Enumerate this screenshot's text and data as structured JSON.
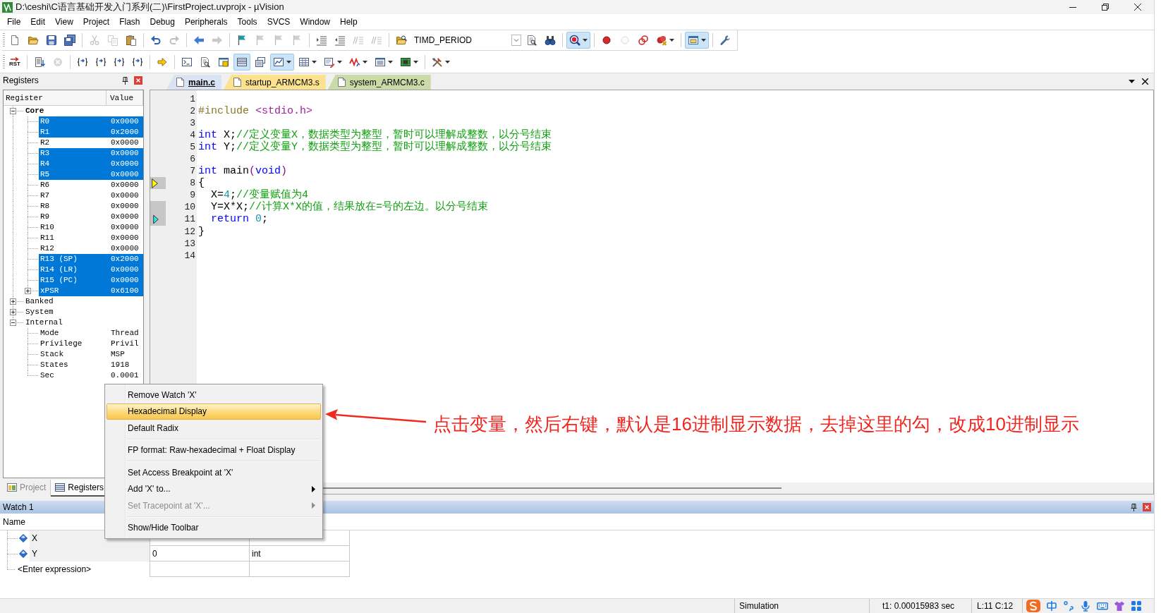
{
  "window": {
    "title": "D:\\ceshi\\C语言基础开发入门系列(二)\\FirstProject.uvprojx - µVision"
  },
  "menu": [
    "File",
    "Edit",
    "View",
    "Project",
    "Flash",
    "Debug",
    "Peripherals",
    "Tools",
    "SVCS",
    "Window",
    "Help"
  ],
  "toolbars": [
    {
      "groups": [
        {
          "items": [
            {
              "kind": "button",
              "disabled": false,
              "pressed": false,
              "dropdown": false
            },
            {
              "kind": "button",
              "disabled": false,
              "pressed": false,
              "dropdown": false
            },
            {
              "kind": "button",
              "disabled": false,
              "pressed": false,
              "dropdown": false
            },
            {
              "kind": "button",
              "disabled": false,
              "pressed": false,
              "dropdown": false
            }
          ]
        },
        {
          "items": [
            {
              "kind": "button",
              "disabled": true,
              "pressed": false,
              "dropdown": false
            },
            {
              "kind": "button",
              "disabled": true,
              "pressed": false,
              "dropdown": false
            },
            {
              "kind": "button",
              "disabled": false,
              "pressed": false,
              "dropdown": false
            }
          ]
        },
        {
          "items": [
            {
              "kind": "button",
              "disabled": false,
              "pressed": false,
              "dropdown": false
            },
            {
              "kind": "button",
              "disabled": true,
              "pressed": false,
              "dropdown": false
            }
          ]
        },
        {
          "items": [
            {
              "kind": "button",
              "disabled": false,
              "pressed": false,
              "dropdown": false
            },
            {
              "kind": "button",
              "disabled": true,
              "pressed": false,
              "dropdown": false
            }
          ]
        },
        {
          "items": [
            {
              "kind": "button",
              "disabled": false,
              "pressed": false,
              "dropdown": false
            },
            {
              "kind": "button",
              "disabled": true,
              "pressed": false,
              "dropdown": false
            },
            {
              "kind": "button",
              "disabled": true,
              "pressed": false,
              "dropdown": false
            },
            {
              "kind": "button",
              "disabled": true,
              "pressed": false,
              "dropdown": false
            }
          ]
        },
        {
          "items": [
            {
              "kind": "button",
              "disabled": false,
              "pressed": false,
              "dropdown": false
            },
            {
              "kind": "button",
              "disabled": false,
              "pressed": false,
              "dropdown": false
            },
            {
              "kind": "button",
              "disabled": true,
              "pressed": false,
              "dropdown": false
            },
            {
              "kind": "button",
              "disabled": true,
              "pressed": false,
              "dropdown": false
            }
          ]
        },
        {
          "items": [
            {
              "kind": "button",
              "disabled": false,
              "pressed": false,
              "dropdown": false
            },
            {
              "kind": "combo",
              "value": "TIMD_PERIOD"
            },
            {
              "kind": "button",
              "disabled": false,
              "pressed": false,
              "dropdown": false
            },
            {
              "kind": "button",
              "disabled": false,
              "pressed": false,
              "dropdown": false
            }
          ]
        },
        {
          "items": [
            {
              "kind": "button",
              "disabled": false,
              "pressed": true,
              "dropdown": true
            }
          ]
        },
        {
          "items": [
            {
              "kind": "button",
              "disabled": false,
              "pressed": false,
              "dropdown": false
            },
            {
              "kind": "button",
              "disabled": true,
              "pressed": false,
              "dropdown": false
            },
            {
              "kind": "button",
              "disabled": false,
              "pressed": false,
              "dropdown": false
            },
            {
              "kind": "button",
              "disabled": false,
              "pressed": false,
              "dropdown": true
            }
          ]
        },
        {
          "items": [
            {
              "kind": "button",
              "disabled": false,
              "pressed": true,
              "dropdown": true
            }
          ]
        },
        {
          "items": [
            {
              "kind": "button",
              "disabled": false,
              "pressed": false,
              "dropdown": false
            }
          ]
        }
      ]
    },
    {
      "groups": [
        {
          "items": [
            {
              "kind": "button",
              "label": "RST",
              "disabled": false,
              "pressed": false,
              "dropdown": false
            }
          ]
        },
        {
          "items": [
            {
              "kind": "button",
              "disabled": false,
              "pressed": false,
              "dropdown": false
            },
            {
              "kind": "button",
              "disabled": true,
              "pressed": false,
              "dropdown": false
            }
          ]
        },
        {
          "items": [
            {
              "kind": "button",
              "disabled": false,
              "pressed": false,
              "dropdown": false
            },
            {
              "kind": "button",
              "disabled": false,
              "pressed": false,
              "dropdown": false
            },
            {
              "kind": "button",
              "disabled": false,
              "pressed": false,
              "dropdown": false
            },
            {
              "kind": "button",
              "disabled": false,
              "pressed": false,
              "dropdown": false
            }
          ]
        },
        {
          "items": [
            {
              "kind": "button",
              "disabled": false,
              "pressed": false,
              "dropdown": false
            }
          ]
        },
        {
          "items": [
            {
              "kind": "button",
              "disabled": false,
              "pressed": false,
              "dropdown": false
            },
            {
              "kind": "button",
              "disabled": false,
              "pressed": false,
              "dropdown": false
            },
            {
              "kind": "button",
              "disabled": false,
              "pressed": false,
              "dropdown": false
            },
            {
              "kind": "button",
              "disabled": false,
              "pressed": true,
              "dropdown": false
            },
            {
              "kind": "button",
              "disabled": false,
              "pressed": false,
              "dropdown": false
            },
            {
              "kind": "button",
              "disabled": false,
              "pressed": true,
              "dropdown": true
            },
            {
              "kind": "button",
              "disabled": false,
              "pressed": false,
              "dropdown": true
            },
            {
              "kind": "button",
              "disabled": false,
              "pressed": false,
              "dropdown": true
            },
            {
              "kind": "button",
              "disabled": false,
              "pressed": false,
              "dropdown": true
            },
            {
              "kind": "button",
              "disabled": false,
              "pressed": false,
              "dropdown": true
            },
            {
              "kind": "button",
              "disabled": false,
              "pressed": false,
              "dropdown": true
            }
          ]
        },
        {
          "items": [
            {
              "kind": "button",
              "disabled": false,
              "pressed": false,
              "dropdown": true
            }
          ]
        }
      ]
    }
  ],
  "registers_panel": {
    "title": "Registers",
    "columns": [
      "Register",
      "Value"
    ],
    "tree": [
      {
        "kind": "node",
        "label": "Core",
        "expanded": true,
        "emphasized": true,
        "changed": false,
        "children": [
          {
            "kind": "leaf",
            "label": "R0",
            "value": "0x0000",
            "changed": true
          },
          {
            "kind": "leaf",
            "label": "R1",
            "value": "0x2000",
            "changed": true
          },
          {
            "kind": "leaf",
            "label": "R2",
            "value": "0x0000",
            "changed": false
          },
          {
            "kind": "leaf",
            "label": "R3",
            "value": "0x0000",
            "changed": true
          },
          {
            "kind": "leaf",
            "label": "R4",
            "value": "0x0000",
            "changed": true
          },
          {
            "kind": "leaf",
            "label": "R5",
            "value": "0x0000",
            "changed": true
          },
          {
            "kind": "leaf",
            "label": "R6",
            "value": "0x0000",
            "changed": false
          },
          {
            "kind": "leaf",
            "label": "R7",
            "value": "0x0000",
            "changed": false
          },
          {
            "kind": "leaf",
            "label": "R8",
            "value": "0x0000",
            "changed": false
          },
          {
            "kind": "leaf",
            "label": "R9",
            "value": "0x0000",
            "changed": false
          },
          {
            "kind": "leaf",
            "label": "R10",
            "value": "0x0000",
            "changed": false
          },
          {
            "kind": "leaf",
            "label": "R11",
            "value": "0x0000",
            "changed": false
          },
          {
            "kind": "leaf",
            "label": "R12",
            "value": "0x0000",
            "changed": false
          },
          {
            "kind": "leaf",
            "label": "R13 (SP)",
            "value": "0x2000",
            "changed": true
          },
          {
            "kind": "leaf",
            "label": "R14 (LR)",
            "value": "0x0000",
            "changed": true
          },
          {
            "kind": "leaf",
            "label": "R15 (PC)",
            "value": "0x0000",
            "changed": true
          },
          {
            "kind": "node",
            "label": "xPSR",
            "value": "0x6100",
            "expanded": false,
            "changed": true
          }
        ]
      },
      {
        "kind": "node",
        "label": "Banked",
        "expanded": false,
        "emphasized": false,
        "changed": false
      },
      {
        "kind": "node",
        "label": "System",
        "expanded": false,
        "emphasized": false,
        "changed": false
      },
      {
        "kind": "node",
        "label": "Internal",
        "expanded": true,
        "emphasized": false,
        "changed": false,
        "children": [
          {
            "kind": "leaf",
            "label": "Mode",
            "value": "Thread",
            "changed": false
          },
          {
            "kind": "leaf",
            "label": "Privilege",
            "value": "Privil",
            "changed": false
          },
          {
            "kind": "leaf",
            "label": "Stack",
            "value": "MSP",
            "changed": false
          },
          {
            "kind": "leaf",
            "label": "States",
            "value": "1918",
            "changed": false
          },
          {
            "kind": "leaf",
            "label": "Sec",
            "value": "0.0001",
            "changed": false
          }
        ]
      }
    ]
  },
  "panel_tabs": [
    {
      "label": "Project",
      "selected": false
    },
    {
      "label": "Registers",
      "selected": true
    }
  ],
  "editor": {
    "tabs": [
      {
        "label": "main.c",
        "selected": true,
        "color": "#d9e3f4"
      },
      {
        "label": "startup_ARMCM3.s",
        "selected": false,
        "color": "#fde28e"
      },
      {
        "label": "system_ARMCM3.c",
        "selected": false,
        "color": "#cbdba8"
      }
    ],
    "lines": [
      {
        "number": "1",
        "shaded": false,
        "current": false,
        "cursor": false
      },
      {
        "number": "2",
        "shaded": false,
        "current": false,
        "cursor": false,
        "tokens": [
          {
            "kind": "preprocessor",
            "text": "#include"
          },
          {
            "kind": "string",
            "text": " <stdio.h>"
          }
        ]
      },
      {
        "number": "3",
        "shaded": false,
        "current": false,
        "cursor": false
      },
      {
        "number": "4",
        "shaded": false,
        "current": false,
        "cursor": false,
        "tokens": [
          {
            "kind": "keyword",
            "text": "int"
          },
          {
            "kind": "plain",
            "text": " X;"
          },
          {
            "kind": "comment",
            "text": "//定义变量X，数据类型为整型，暂时可以理解成整数，以分号结束"
          }
        ]
      },
      {
        "number": "5",
        "shaded": false,
        "current": false,
        "cursor": false,
        "tokens": [
          {
            "kind": "keyword",
            "text": "int"
          },
          {
            "kind": "plain",
            "text": " Y;"
          },
          {
            "kind": "comment",
            "text": "//定义变量Y，数据类型为整型，暂时可以理解成整数，以分号结束"
          }
        ]
      },
      {
        "number": "6",
        "shaded": false,
        "current": false,
        "cursor": false
      },
      {
        "number": "7",
        "shaded": false,
        "current": false,
        "cursor": false,
        "tokens": [
          {
            "kind": "keyword",
            "text": "int"
          },
          {
            "kind": "plain",
            "text": " main"
          },
          {
            "kind": "operator",
            "text": "("
          },
          {
            "kind": "keyword",
            "text": "void"
          },
          {
            "kind": "operator",
            "text": ")"
          }
        ]
      },
      {
        "number": "8",
        "shaded": true,
        "current": true,
        "cursor": false,
        "tokens": [
          {
            "kind": "plain",
            "text": "{"
          }
        ]
      },
      {
        "number": "9",
        "shaded": false,
        "current": false,
        "cursor": false,
        "tokens": [
          {
            "kind": "plain",
            "text": "  X="
          },
          {
            "kind": "number",
            "text": "4"
          },
          {
            "kind": "plain",
            "text": ";"
          },
          {
            "kind": "comment",
            "text": "//变量赋值为4"
          }
        ]
      },
      {
        "number": "10",
        "shaded": true,
        "current": false,
        "cursor": false,
        "tokens": [
          {
            "kind": "plain",
            "text": "  Y=X*X;"
          },
          {
            "kind": "comment",
            "text": "//计算X*X的值，结果放在=号的左边。以分号结束"
          }
        ]
      },
      {
        "number": "11",
        "shaded": true,
        "current": false,
        "cursor": true,
        "tokens": [
          {
            "kind": "keyword",
            "text": "  return"
          },
          {
            "kind": "number",
            "text": " 0"
          },
          {
            "kind": "plain",
            "text": ";"
          }
        ]
      },
      {
        "number": "12",
        "shaded": false,
        "current": false,
        "cursor": false,
        "tokens": [
          {
            "kind": "plain",
            "text": "}"
          }
        ]
      },
      {
        "number": "13",
        "shaded": false,
        "current": false,
        "cursor": false
      },
      {
        "number": "14",
        "shaded": false,
        "current": false,
        "cursor": false
      }
    ]
  },
  "watch": {
    "title": "Watch 1",
    "columns": [
      "Name"
    ],
    "rows": [
      {
        "kind": "variable",
        "name": "X"
      },
      {
        "kind": "variable",
        "name": "Y",
        "value": "0",
        "type": "int"
      },
      {
        "kind": "entry",
        "name": "<Enter expression>"
      }
    ]
  },
  "context_menu": {
    "items": [
      {
        "kind": "item",
        "label": "Remove Watch 'X'",
        "highlighted": false,
        "disabled": false,
        "submenu": false
      },
      {
        "kind": "item",
        "label": "Hexadecimal Display",
        "highlighted": true,
        "disabled": false,
        "submenu": false
      },
      {
        "kind": "item",
        "label": "Default Radix",
        "highlighted": false,
        "disabled": false,
        "submenu": false
      },
      {
        "kind": "separator"
      },
      {
        "kind": "item",
        "label": "FP format: Raw-hexadecimal + Float Display",
        "highlighted": false,
        "disabled": false,
        "submenu": false
      },
      {
        "kind": "separator"
      },
      {
        "kind": "item",
        "label": "Set Access Breakpoint at 'X'",
        "highlighted": false,
        "disabled": false,
        "submenu": false
      },
      {
        "kind": "item",
        "label": "Add 'X' to...",
        "highlighted": false,
        "disabled": false,
        "submenu": true
      },
      {
        "kind": "item",
        "label": "Set Tracepoint at 'X'...",
        "highlighted": false,
        "disabled": true,
        "submenu": true
      },
      {
        "kind": "separator"
      },
      {
        "kind": "item",
        "label": "Show/Hide Toolbar",
        "highlighted": false,
        "disabled": false,
        "submenu": false
      }
    ]
  },
  "annotation": {
    "text": "点击变量，然后右键，默认是16进制显示数据，去掉这里的勾，改成10进制显示"
  },
  "status_bar": {
    "mode": "Simulation",
    "time": "t1: 0.00015983 sec",
    "cursor": "L:11 C:12"
  }
}
